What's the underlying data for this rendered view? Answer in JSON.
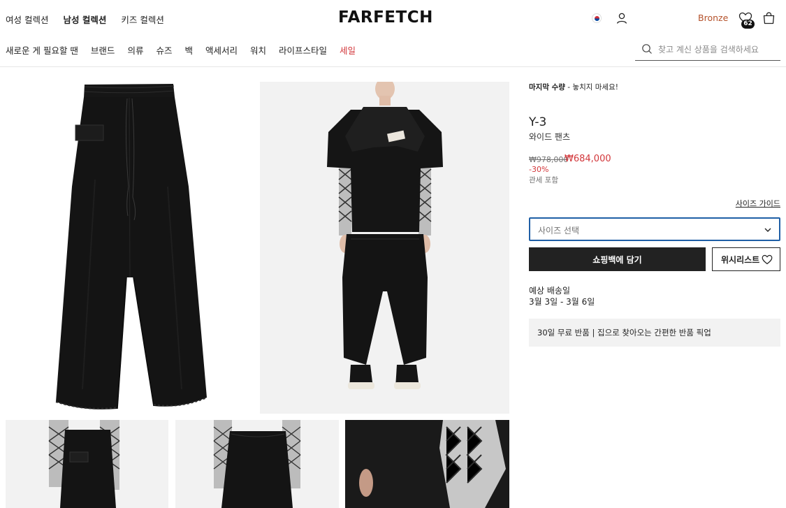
{
  "header": {
    "gender_nav": [
      "여성 컬렉션",
      "남성 컬렉션",
      "키즈 컬렉션"
    ],
    "active_gender": "남성 컬렉션",
    "logo": "FARFETCH",
    "flag_icon": "korea-flag-icon",
    "tier": "Bronze",
    "wishlist_count": "62",
    "categories": [
      "새로운 게 필요할 땐",
      "브랜드",
      "의류",
      "슈즈",
      "백",
      "액세서리",
      "워치",
      "라이프스타일",
      "세일"
    ],
    "search_placeholder": "찾고 계신 상품을 검색하세요"
  },
  "product": {
    "low_stock_label": "마지막 수량",
    "low_stock_note": " - 놓치지 마세요!",
    "brand": "Y-3",
    "name": "와이드 팬츠",
    "original_price": "₩978,000",
    "sale_price": "₩684,000",
    "discount": "-30%",
    "duty_note": "관세 포함",
    "size_guide": "사이즈 가이드",
    "size_select_label": "사이즈 선택",
    "add_to_bag": "쇼핑백에 담기",
    "wishlist": "위시리스트",
    "delivery_label": "예상 배송일",
    "delivery_dates": "3월 3일 - 3월 6일",
    "returns_text": "30일 무료 반품 | 집으로 찾아오는 간편한 반품 픽업"
  },
  "colors": {
    "sale_red": "#d2363a",
    "tier_orange": "#b4512a",
    "select_border": "#1f5fa6",
    "dark_button": "#222222"
  }
}
